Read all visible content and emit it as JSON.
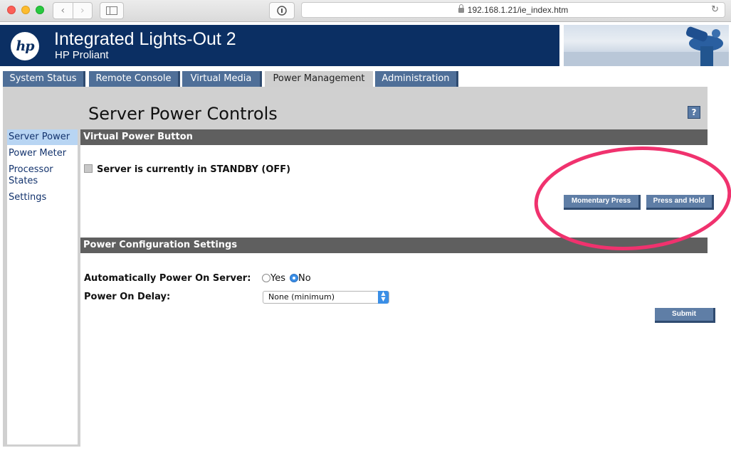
{
  "browser": {
    "url": "192.168.1.21/ie_index.htm",
    "back_icon": "chevron-left-icon",
    "forward_icon": "chevron-right-icon",
    "reload_icon": "reload-icon"
  },
  "header": {
    "logo_text": "hp",
    "title": "Integrated Lights-Out 2",
    "subtitle": "HP Proliant",
    "bg_color": "#0b2f63"
  },
  "tabs": [
    {
      "label": "System Status",
      "active": false
    },
    {
      "label": "Remote Console",
      "active": false
    },
    {
      "label": "Virtual Media",
      "active": false
    },
    {
      "label": "Power Management",
      "active": true
    },
    {
      "label": "Administration",
      "active": false
    }
  ],
  "sidebar": {
    "items": [
      {
        "label": "Server Power",
        "active": true
      },
      {
        "label": "Power Meter",
        "active": false
      },
      {
        "label": "Processor States",
        "active": false
      },
      {
        "label": "Settings",
        "active": false
      }
    ]
  },
  "main": {
    "page_title": "Server Power Controls",
    "help_label": "?",
    "virtual_power": {
      "section_title": "Virtual Power Button",
      "status_text": "Server is currently in STANDBY (OFF)",
      "momentary_press_label": "Momentary Press",
      "press_and_hold_label": "Press and Hold"
    },
    "power_config": {
      "section_title": "Power Configuration Settings",
      "auto_power_label": "Automatically Power On Server:",
      "yes_label": "Yes",
      "no_label": "No",
      "selected": "No",
      "delay_label": "Power On Delay:",
      "delay_value": "None (minimum)",
      "submit_label": "Submit"
    }
  },
  "annotation": {
    "color": "#f0326e"
  }
}
